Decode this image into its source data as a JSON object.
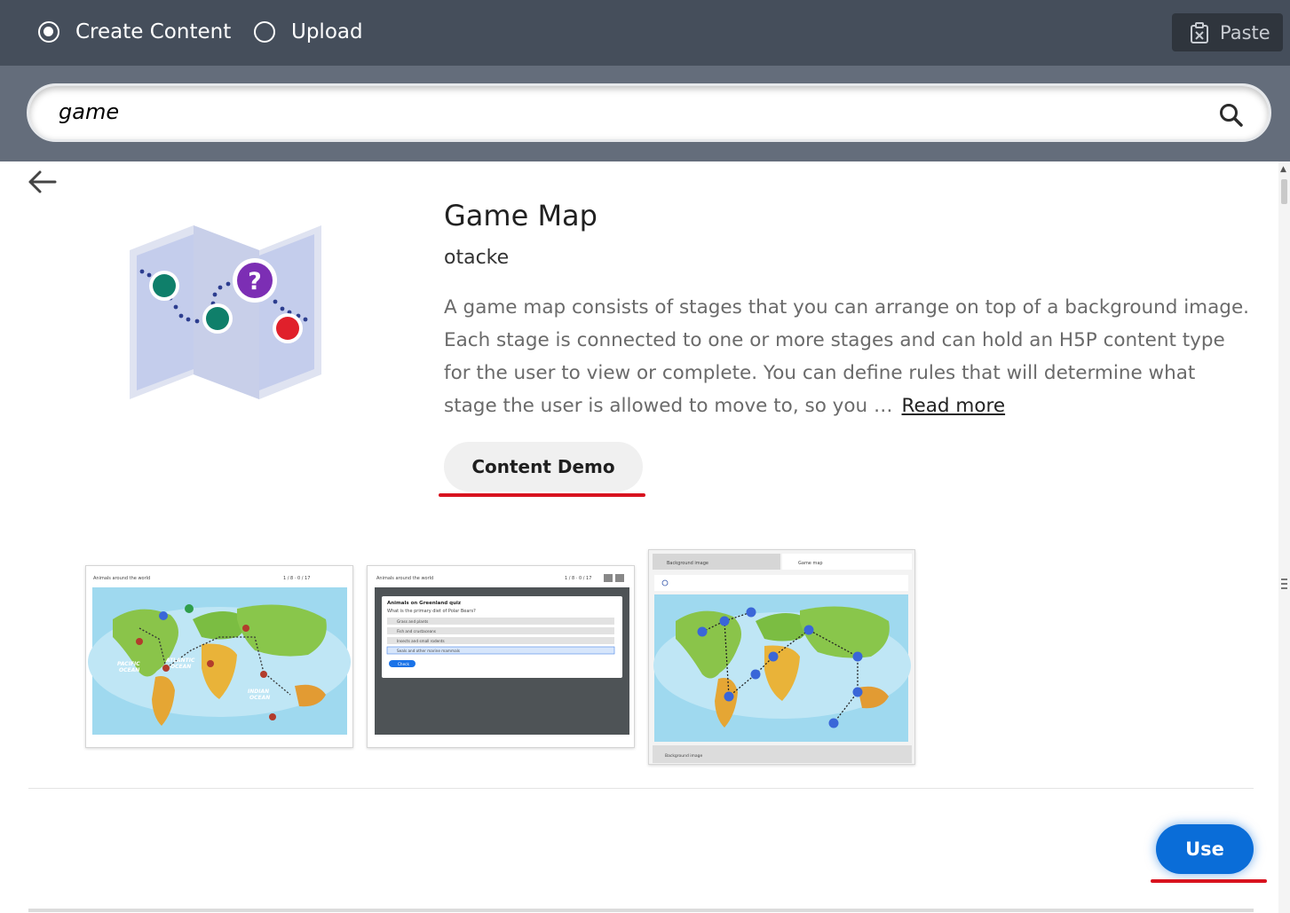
{
  "topbar": {
    "create_label": "Create Content",
    "upload_label": "Upload",
    "paste_label": "Paste",
    "selected": "Create Content"
  },
  "search": {
    "value": "game"
  },
  "content_type": {
    "title": "Game Map",
    "owner": "otacke",
    "description": "A game map consists of stages that you can arrange on top of a background image. Each stage is connected to one or more stages and can hold an H5P content type for the user to view or complete. You can define rules that will determine what stage the user is allowed to move to, so you …",
    "read_more_label": "Read more",
    "demo_label": "Content Demo",
    "use_label": "Use"
  },
  "screenshots": [
    {
      "header_title": "Animals around the world",
      "counter": "1 / 8 · 0 / 17"
    },
    {
      "header_title": "Animals around the world",
      "counter": "1 / 8 · 0 / 17",
      "quiz_title": "Animals on Greenland quiz",
      "question": "What is the primary diet of Polar Bears?",
      "options": [
        "Grass and plants",
        "Fish and crustaceans",
        "Insects and small rodents",
        "Seals and other marine mammals"
      ],
      "check_label": "Check"
    },
    {
      "step1": "Background image",
      "step2": "Game map",
      "prev_label": "Background image"
    }
  ],
  "colors": {
    "topbar": "#454e5b",
    "searchbar": "#646d7b",
    "accent": "#0a6dd8",
    "annotation_red": "#d8131f"
  }
}
